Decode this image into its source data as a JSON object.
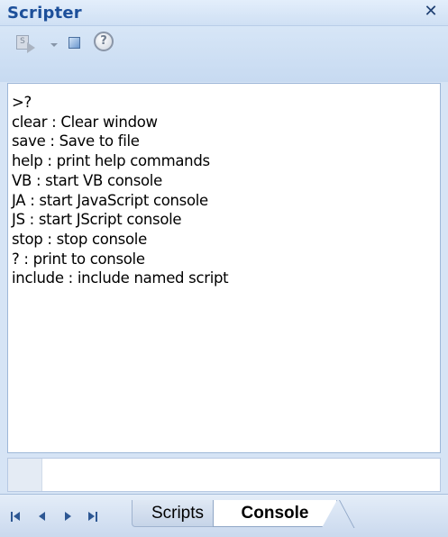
{
  "window": {
    "title": "Scripter",
    "close_glyph": "✕"
  },
  "toolbar": {
    "run_icon": "run-script-icon",
    "dropdown_icon": "chevron-down-icon",
    "stop_icon": "stop-icon",
    "help_icon": "help-icon",
    "help_glyph": "?"
  },
  "console": {
    "lines": [
      ">?",
      "clear : Clear window",
      "save : Save to file",
      "help : print help commands",
      "VB : start VB console",
      "JA : start JavaScript console",
      "JS : start JScript console",
      "stop : stop console",
      "? : print to console",
      "include : include named script"
    ],
    "input_value": "",
    "input_placeholder": ""
  },
  "tabs": {
    "items": [
      {
        "label": "Scripts",
        "active": false
      },
      {
        "label": "Console",
        "active": true
      }
    ]
  },
  "nav": {
    "first_icon": "nav-first-icon",
    "prev_icon": "nav-prev-icon",
    "next_icon": "nav-next-icon",
    "last_icon": "nav-last-icon"
  },
  "colors": {
    "title_text": "#1c4f9a",
    "panel_background": "#d6e4f5",
    "nav_arrows": "#2d5793"
  }
}
